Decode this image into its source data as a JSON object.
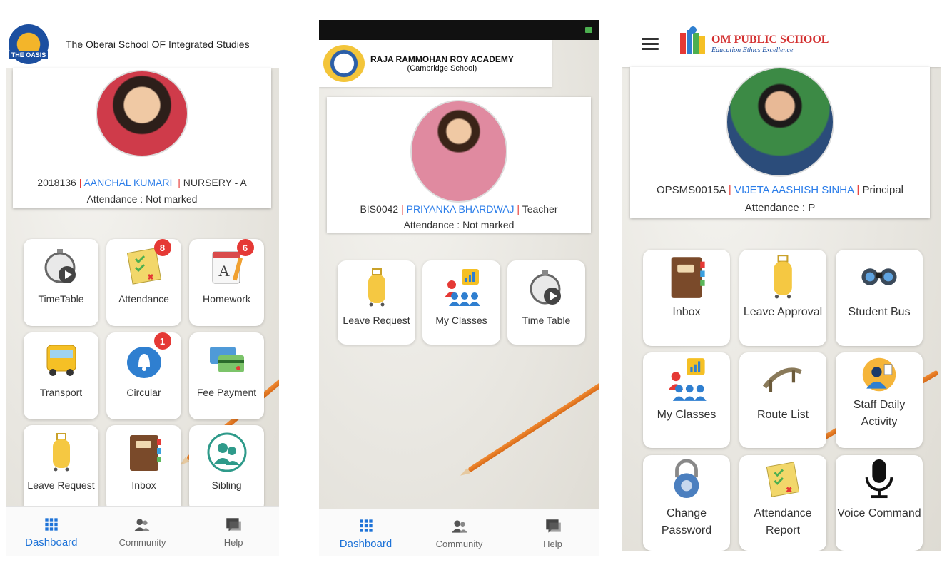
{
  "phone1": {
    "school_name": "The Oberai School OF Integrated Studies",
    "logo_text": "THE OASIS",
    "profile": {
      "id": "2018136",
      "name": "AANCHAL KUMARI",
      "role": "NURSERY - A",
      "attendance": "Attendance : Not marked"
    },
    "tiles": [
      {
        "label": "TimeTable",
        "icon": "stopwatch-play-icon",
        "badge": ""
      },
      {
        "label": "Attendance",
        "icon": "checklist-icon",
        "badge": "8"
      },
      {
        "label": "Homework",
        "icon": "notepad-icon",
        "badge": "6"
      },
      {
        "label": "Transport",
        "icon": "bus-icon",
        "badge": ""
      },
      {
        "label": "Circular",
        "icon": "bell-icon",
        "badge": "1"
      },
      {
        "label": "Fee Payment",
        "icon": "credit-cards-icon",
        "badge": ""
      },
      {
        "label": "Leave Request",
        "icon": "luggage-icon",
        "badge": ""
      },
      {
        "label": "Inbox",
        "icon": "diary-icon",
        "badge": ""
      },
      {
        "label": "Sibling",
        "icon": "siblings-icon",
        "badge": ""
      }
    ],
    "nav": {
      "dashboard": "Dashboard",
      "community": "Community",
      "help": "Help"
    }
  },
  "phone2": {
    "school_name": "RAJA RAMMOHAN ROY ACADEMY",
    "school_sub": "(Cambridge School)",
    "profile": {
      "id": "BIS0042",
      "name": "PRIYANKA BHARDWAJ",
      "role": "Teacher",
      "attendance": "Attendance : Not marked"
    },
    "tiles": [
      {
        "label": "Leave Request",
        "icon": "luggage-icon"
      },
      {
        "label": "My Classes",
        "icon": "classroom-chart-icon"
      },
      {
        "label": "Time Table",
        "icon": "stopwatch-play-icon"
      }
    ],
    "nav": {
      "dashboard": "Dashboard",
      "community": "Community",
      "help": "Help"
    }
  },
  "phone3": {
    "school_name": "OM PUBLIC SCHOOL",
    "tagline": "Education Ethics Excellence",
    "profile": {
      "id": "OPSMS0015A",
      "name": "VIJETA AASHISH SINHA",
      "role": "Principal",
      "attendance": "Attendance : P"
    },
    "tiles": [
      {
        "label": "Inbox",
        "icon": "diary-icon"
      },
      {
        "label": "Leave Approval",
        "icon": "luggage-icon"
      },
      {
        "label": "Student Bus",
        "icon": "binoculars-icon"
      },
      {
        "label": "My Classes",
        "icon": "classroom-chart-icon"
      },
      {
        "label": "Route List",
        "icon": "bridge-icon"
      },
      {
        "label": "Staff Daily Activity",
        "icon": "worker-icon"
      },
      {
        "label": "Change Password",
        "icon": "padlock-icon"
      },
      {
        "label": "Attendance Report",
        "icon": "checklist-icon"
      },
      {
        "label": "Voice Command",
        "icon": "microphone-icon"
      }
    ]
  },
  "colors": {
    "accent": "#1e73d8",
    "name_link": "#2b7de9",
    "separator": "#e53935",
    "badge": "#e53935"
  }
}
